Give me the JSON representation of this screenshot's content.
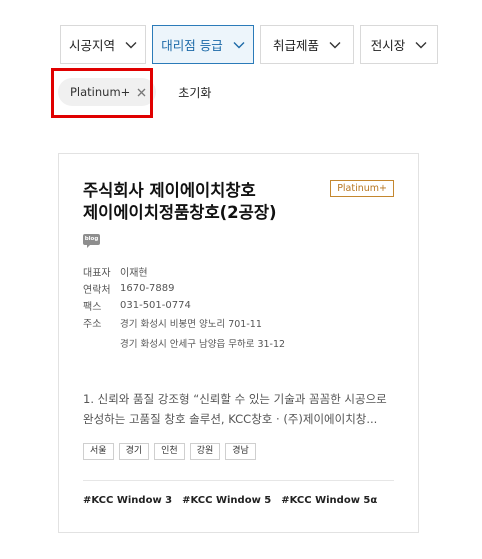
{
  "filters": [
    {
      "label": "시공지역",
      "active": false
    },
    {
      "label": "대리점 등급",
      "active": true
    },
    {
      "label": "취급제품",
      "active": false
    },
    {
      "label": "전시장",
      "active": false
    }
  ],
  "selected_tags": {
    "chip_label": "Platinum+",
    "reset_label": "초기화"
  },
  "card": {
    "name_line1": "주식회사 제이에이치창호",
    "name_line2": "제이에이치정품창호(2공장)",
    "grade": "Platinum+",
    "blog_label": "blog",
    "info": {
      "rep_label": "대표자",
      "rep": "이재현",
      "phone_label": "연락처",
      "phone": "1670-7889",
      "fax_label": "팩스",
      "fax": "031-501-0774",
      "addr_label": "주소",
      "addr1": "경기 화성시 비봉면 양노리 701-11",
      "addr2": "경기 화성시 안세구 남양읍 무하로 31-12"
    },
    "description": "1. 신뢰와 품질 강조형 “신뢰할 수 있는 기술과 꼼꼼한 시공으로 완성하는 고품질 창호 솔루션, KCC창호 · (주)제이에이치창...",
    "regions": [
      "서울",
      "경기",
      "인천",
      "강원",
      "경남"
    ],
    "hashtags": [
      "#KCC Window 3",
      "#KCC Window 5",
      "#KCC Window 5α"
    ]
  },
  "colors": {
    "active_border": "#2b7bb9",
    "active_bg": "#edf5fb",
    "grade_gold": "#c4872f",
    "highlight_red": "#e00000"
  }
}
